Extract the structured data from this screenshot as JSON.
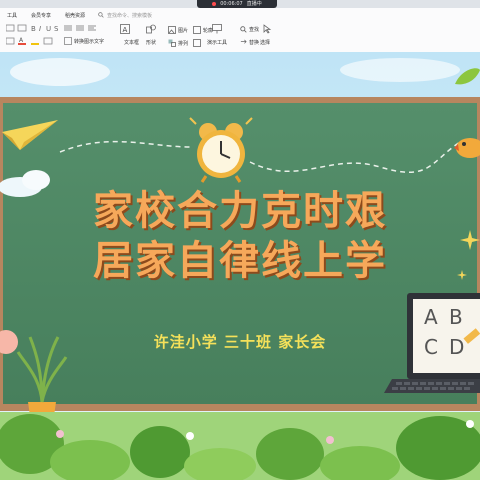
{
  "status": {
    "time": "00:06:07",
    "live_label": "直播中"
  },
  "menubar": {
    "items": [
      "工具",
      "会员专享",
      "稻壳资源"
    ],
    "search_placeholder": "查找命令、搜索模板"
  },
  "toolbar": {
    "text_box": "文本框",
    "shape": "形状",
    "image": "图片",
    "arrange": "排列",
    "outline": "轮廓",
    "present_tools": "演示工具",
    "replace": "替换",
    "select": "选择",
    "find": "查找",
    "convert_art": "转换图示文字"
  },
  "slide": {
    "title_line1": "家校合力克时艰",
    "title_line2": "居家自律线上学",
    "subtitle": "许洼小学 三十班 家长会",
    "board_letters": [
      "A",
      "B",
      "C",
      "D"
    ]
  },
  "colors": {
    "chalkboard": "#4f8b66",
    "frame": "#b7865f",
    "title": "#f6a85a",
    "subtitle": "#f5e15a",
    "sky": "#cfe9f7"
  },
  "icons": [
    "live-dot-icon",
    "search-icon",
    "textbox-icon",
    "shape-icon",
    "image-icon",
    "arrange-icon",
    "outline-icon",
    "present-tools-icon",
    "replace-icon",
    "select-icon",
    "paper-plane-icon",
    "alarm-clock-icon",
    "bird-icon",
    "sparkle-icon",
    "laptop-icon",
    "plant-icon"
  ]
}
